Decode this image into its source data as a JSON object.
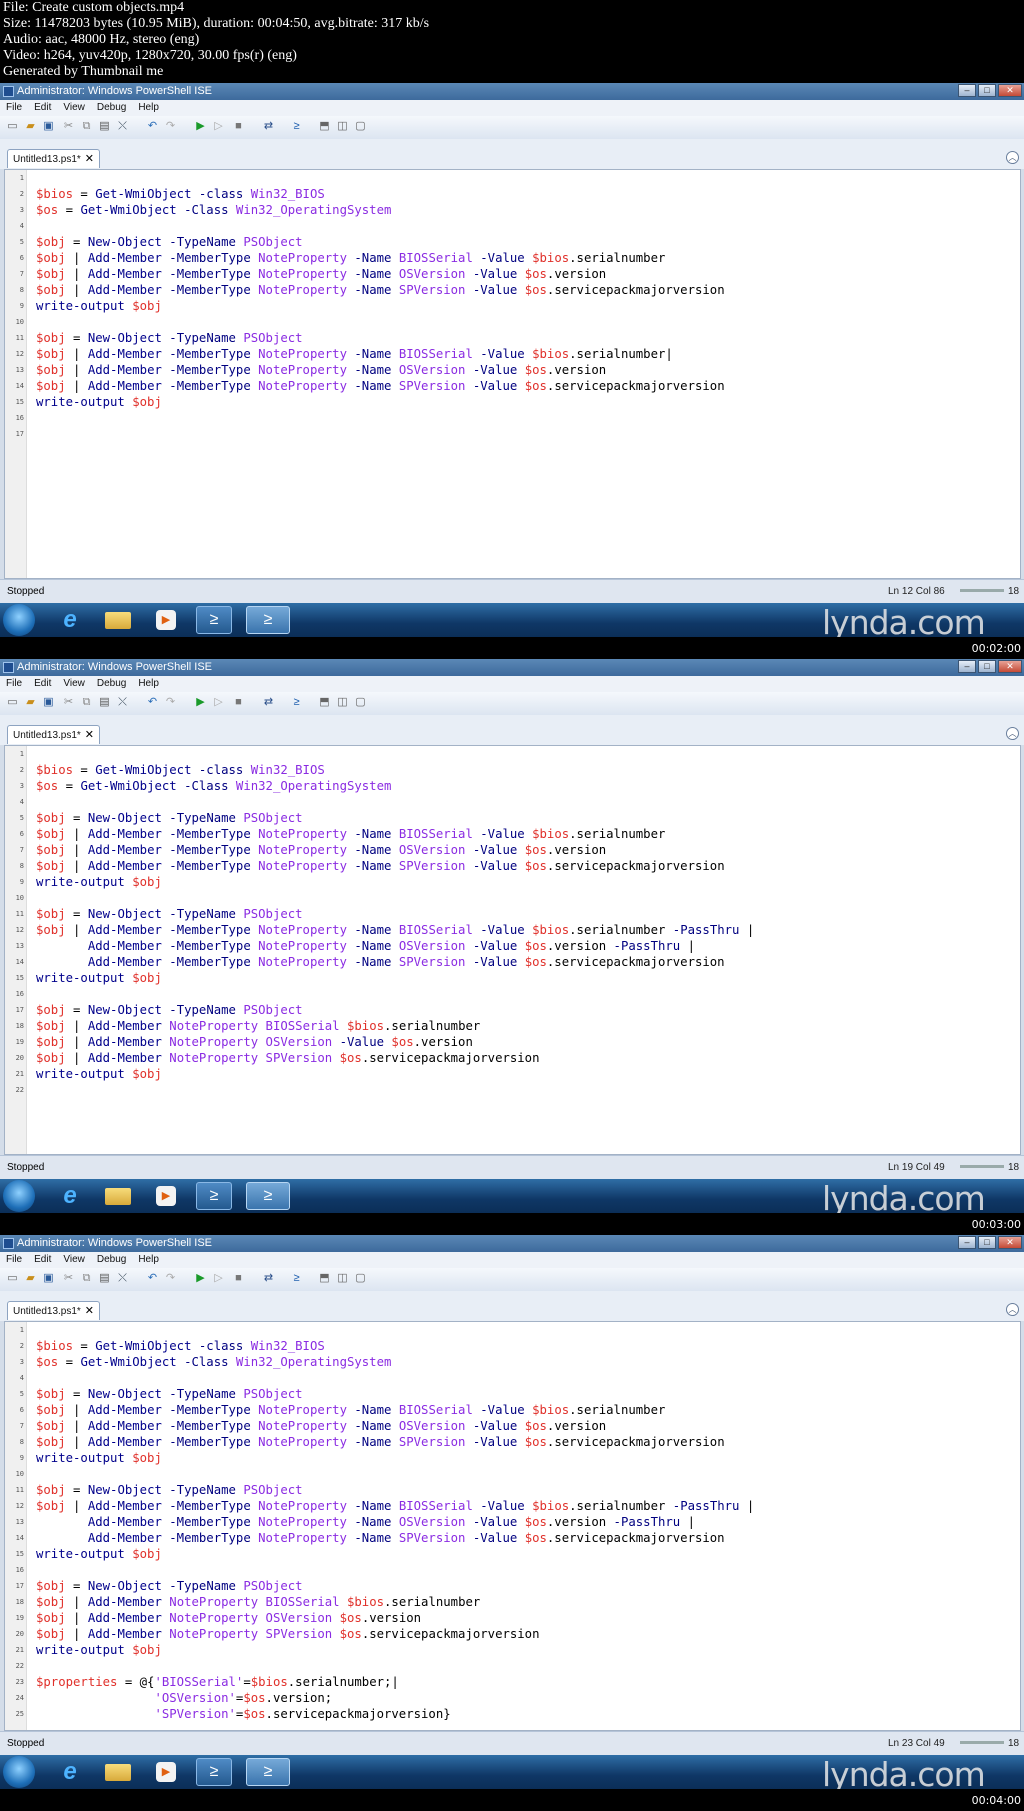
{
  "meta": {
    "lines": [
      "File: Create custom objects.mp4",
      "Size: 11478203 bytes (10.95 MiB), duration: 00:04:50, avg.bitrate: 317 kb/s",
      "Audio: aac, 48000 Hz, stereo (eng)",
      "Video: h264, yuv420p, 1280x720, 30.00 fps(r) (eng)",
      "Generated by Thumbnail me"
    ]
  },
  "window": {
    "title": "Administrator: Windows PowerShell ISE"
  },
  "menu": [
    "File",
    "Edit",
    "View",
    "Debug",
    "Help"
  ],
  "tab": {
    "label": "Untitled13.ps1*",
    "close": "✕"
  },
  "status": {
    "state": "Stopped",
    "zoom": "18"
  },
  "watermark": "lynda.com",
  "frames": [
    {
      "timestamp": "00:02:00",
      "position": "Ln 12  Col 86",
      "line_numbers": [
        "1",
        "2",
        "3",
        "4",
        "5",
        "6",
        "7",
        "8",
        "9",
        "10",
        "11",
        "12",
        "13",
        "14",
        "15",
        "16",
        "17"
      ],
      "code": [
        "",
        "$bios = Get-WmiObject -class Win32_BIOS",
        "$os = Get-WmiObject -Class Win32_OperatingSystem",
        "",
        "$obj = New-Object -TypeName PSObject",
        "$obj | Add-Member -MemberType NoteProperty -Name BIOSSerial -Value $bios.serialnumber",
        "$obj | Add-Member -MemberType NoteProperty -Name OSVersion -Value $os.version",
        "$obj | Add-Member -MemberType NoteProperty -Name SPVersion -Value $os.servicepackmajorversion",
        "write-output $obj",
        "",
        "$obj = New-Object -TypeName PSObject",
        "$obj | Add-Member -MemberType NoteProperty -Name BIOSSerial -Value $bios.serialnumber|",
        "$obj | Add-Member -MemberType NoteProperty -Name OSVersion -Value $os.version",
        "$obj | Add-Member -MemberType NoteProperty -Name SPVersion -Value $os.servicepackmajorversion",
        "write-output $obj",
        "",
        ""
      ]
    },
    {
      "timestamp": "00:03:00",
      "position": "Ln 19  Col 49",
      "line_numbers": [
        "1",
        "2",
        "3",
        "4",
        "5",
        "6",
        "7",
        "8",
        "9",
        "10",
        "11",
        "12",
        "13",
        "14",
        "15",
        "16",
        "17",
        "18",
        "19",
        "20",
        "21",
        "22"
      ],
      "code": [
        "",
        "$bios = Get-WmiObject -class Win32_BIOS",
        "$os = Get-WmiObject -Class Win32_OperatingSystem",
        "",
        "$obj = New-Object -TypeName PSObject",
        "$obj | Add-Member -MemberType NoteProperty -Name BIOSSerial -Value $bios.serialnumber",
        "$obj | Add-Member -MemberType NoteProperty -Name OSVersion -Value $os.version",
        "$obj | Add-Member -MemberType NoteProperty -Name SPVersion -Value $os.servicepackmajorversion",
        "write-output $obj",
        "",
        "$obj = New-Object -TypeName PSObject",
        "$obj | Add-Member -MemberType NoteProperty -Name BIOSSerial -Value $bios.serialnumber -PassThru |",
        "       Add-Member -MemberType NoteProperty -Name OSVersion -Value $os.version -PassThru |",
        "       Add-Member -MemberType NoteProperty -Name SPVersion -Value $os.servicepackmajorversion",
        "write-output $obj",
        "",
        "$obj = New-Object -TypeName PSObject",
        "$obj | Add-Member NoteProperty BIOSSerial $bios.serialnumber",
        "$obj | Add-Member NoteProperty OSVersion -Value $os.version",
        "$obj | Add-Member NoteProperty SPVersion $os.servicepackmajorversion",
        "write-output $obj",
        ""
      ]
    },
    {
      "timestamp": "00:04:00",
      "position": "Ln 23  Col 49",
      "line_numbers": [
        "1",
        "2",
        "3",
        "4",
        "5",
        "6",
        "7",
        "8",
        "9",
        "10",
        "11",
        "12",
        "13",
        "14",
        "15",
        "16",
        "17",
        "18",
        "19",
        "20",
        "21",
        "22",
        "23",
        "24",
        "25"
      ],
      "code": [
        "",
        "$bios = Get-WmiObject -class Win32_BIOS",
        "$os = Get-WmiObject -Class Win32_OperatingSystem",
        "",
        "$obj = New-Object -TypeName PSObject",
        "$obj | Add-Member -MemberType NoteProperty -Name BIOSSerial -Value $bios.serialnumber",
        "$obj | Add-Member -MemberType NoteProperty -Name OSVersion -Value $os.version",
        "$obj | Add-Member -MemberType NoteProperty -Name SPVersion -Value $os.servicepackmajorversion",
        "write-output $obj",
        "",
        "$obj = New-Object -TypeName PSObject",
        "$obj | Add-Member -MemberType NoteProperty -Name BIOSSerial -Value $bios.serialnumber -PassThru |",
        "       Add-Member -MemberType NoteProperty -Name OSVersion -Value $os.version -PassThru |",
        "       Add-Member -MemberType NoteProperty -Name SPVersion -Value $os.servicepackmajorversion",
        "write-output $obj",
        "",
        "$obj = New-Object -TypeName PSObject",
        "$obj | Add-Member NoteProperty BIOSSerial $bios.serialnumber",
        "$obj | Add-Member NoteProperty OSVersion $os.version",
        "$obj | Add-Member NoteProperty SPVersion $os.servicepackmajorversion",
        "write-output $obj",
        "",
        "$properties = @{'BIOSSerial'=$bios.serialnumber;|",
        "                'OSVersion'=$os.version;",
        "                'SPVersion'=$os.servicepackmajorversion}"
      ]
    }
  ]
}
